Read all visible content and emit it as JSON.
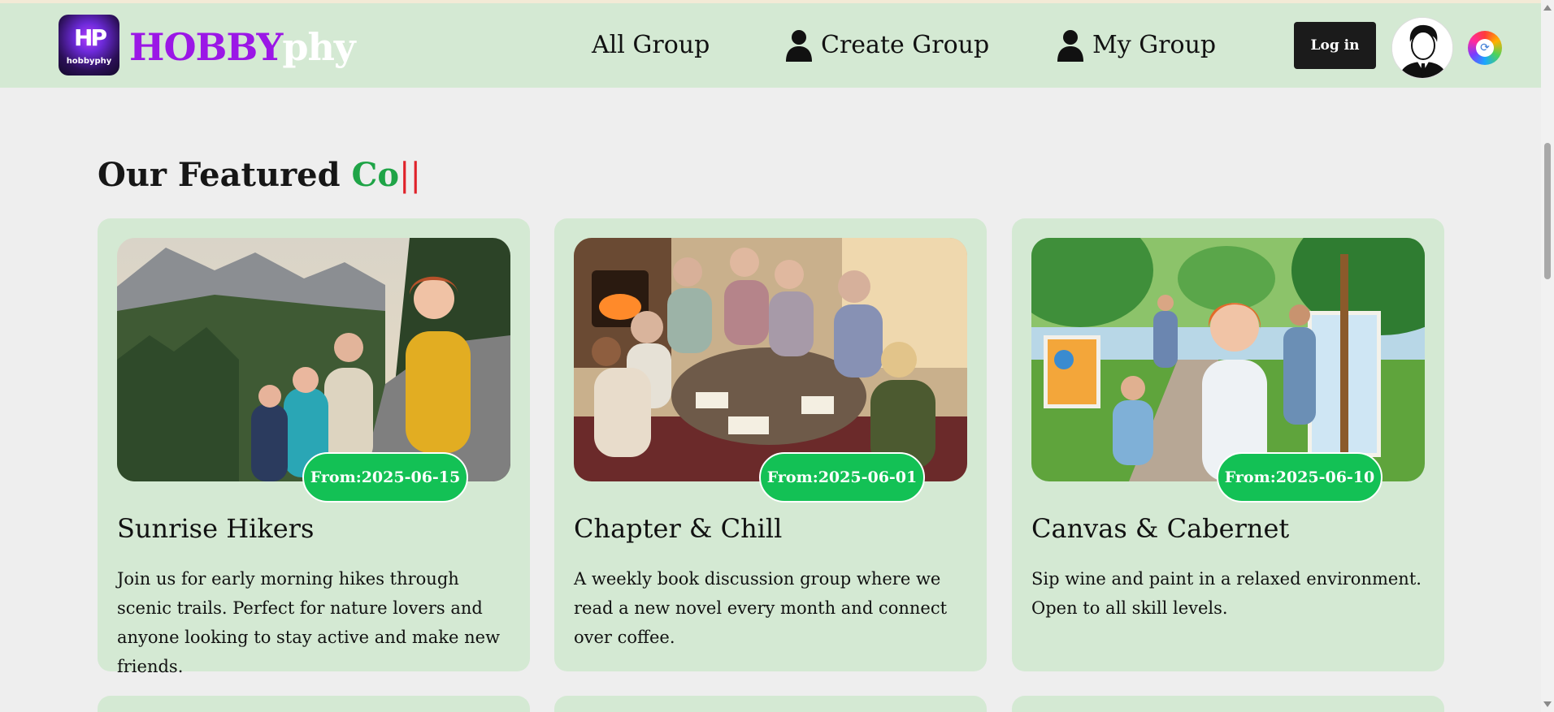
{
  "header": {
    "logo_caption": "hobbyphy",
    "logo_mark": "HP",
    "brand_first": "HOBBY",
    "brand_second": "phy",
    "nav": {
      "all_group": "All Group",
      "create_group": "Create Group",
      "my_group": "My Group"
    },
    "login_label": "Log in"
  },
  "section": {
    "title_main": "Our Featured ",
    "title_accent": "Co",
    "title_caret": "||"
  },
  "cards": [
    {
      "date": "From:2025-06-15",
      "title": "Sunrise Hikers",
      "description": "Join us for early morning hikes through scenic trails. Perfect for nature lovers and anyone looking to stay active and make new friends."
    },
    {
      "date": "From:2025-06-01",
      "title": "Chapter & Chill",
      "description": "A weekly book discussion group where we read a new novel every month and connect over coffee."
    },
    {
      "date": "From:2025-06-10",
      "title": "Canvas & Cabernet",
      "description": "Sip wine and paint in a relaxed environment. Open to all skill levels."
    }
  ],
  "colors": {
    "nav_bg": "#d4e9d3",
    "brand_purple": "#9b17e6",
    "badge_green": "#13c155",
    "accent_green": "#1fa447"
  }
}
